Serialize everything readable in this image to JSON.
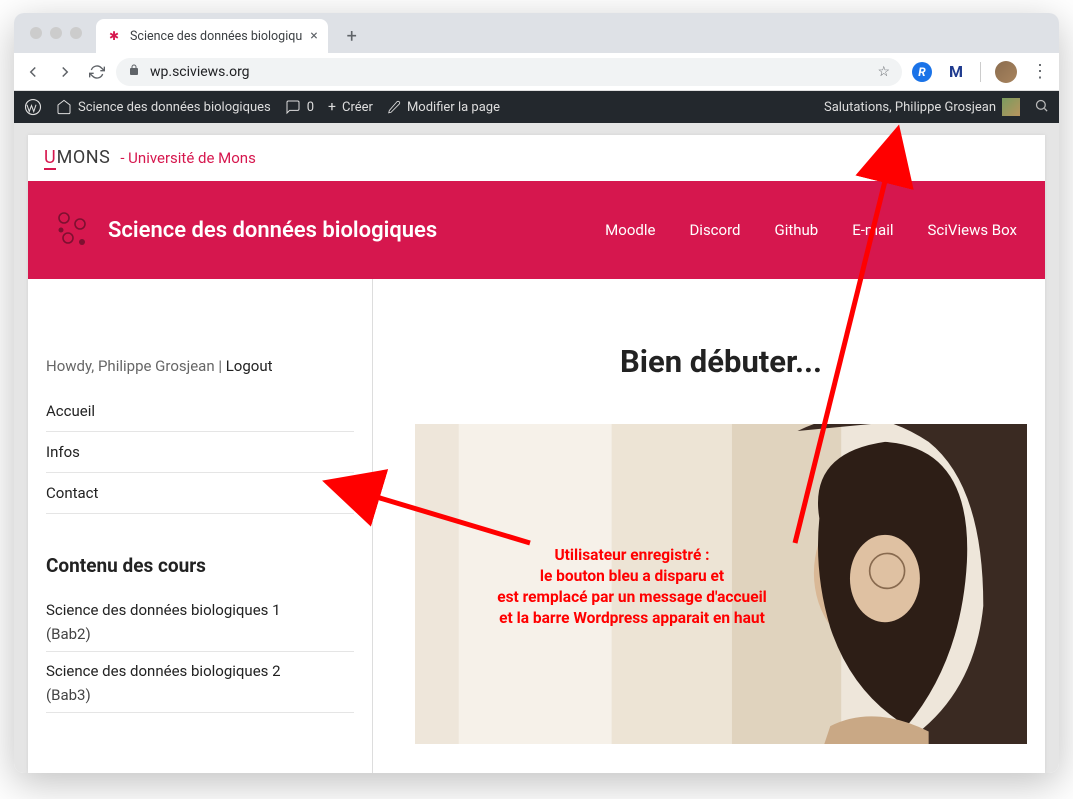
{
  "browser": {
    "tab_title": "Science des données biologiqu",
    "url": "wp.sciviews.org"
  },
  "wp_bar": {
    "site_name": "Science des données biologiques",
    "comments_count": "0",
    "new_label": "Créer",
    "edit_label": "Modifier la page",
    "greeting": "Salutations, Philippe Grosjean"
  },
  "umons": {
    "logo_u": "U",
    "logo_mons": "MONS",
    "subtitle": "- Université de Mons"
  },
  "banner": {
    "title": "Science des données biologiques",
    "nav": [
      "Moodle",
      "Discord",
      "Github",
      "E-mail",
      "SciViews Box"
    ]
  },
  "sidebar": {
    "howdy": "Howdy, Philippe Grosjean",
    "sep": " | ",
    "logout": "Logout",
    "links": [
      "Accueil",
      "Infos",
      "Contact"
    ],
    "courses_heading": "Contenu des cours",
    "courses": [
      {
        "title": "Science des données biologiques 1",
        "sub": "(Bab2)"
      },
      {
        "title": "Science des données biologiques 2",
        "sub": "(Bab3)"
      }
    ]
  },
  "main": {
    "title": "Bien débuter..."
  },
  "annotation": {
    "line1": "Utilisateur enregistré :",
    "line2": "le bouton bleu a disparu et",
    "line3": "est remplacé par un message d'accueil",
    "line4": "et la barre Wordpress apparait en haut"
  }
}
